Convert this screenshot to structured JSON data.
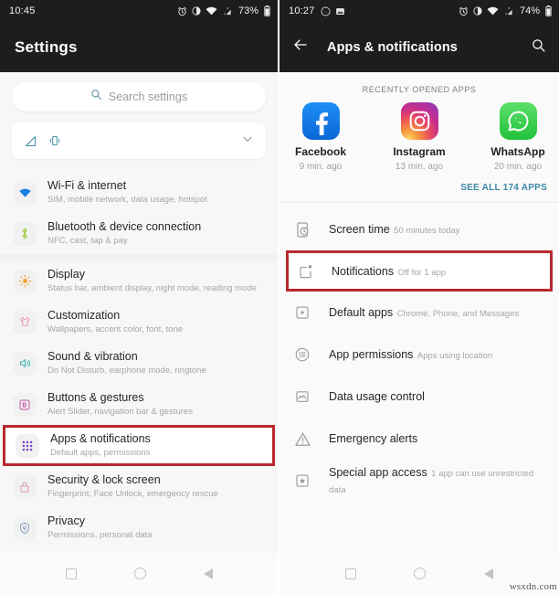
{
  "left": {
    "status": {
      "clock": "10:45",
      "battery_pct": "73%",
      "icons": [
        "alarm-icon",
        "dnd-icon",
        "wifi-icon",
        "signal-off-icon",
        "battery-icon"
      ]
    },
    "appbar": {
      "title": "Settings"
    },
    "search": {
      "placeholder": "Search settings",
      "icon": "search-icon"
    },
    "quick_settings": {
      "icons": [
        "signal-off-icon",
        "vibrate-icon"
      ],
      "expand_icon": "chevron-down-icon"
    },
    "groups": [
      {
        "items": [
          {
            "title": "Wi-Fi & internet",
            "subtitle": "SIM, mobile network, data usage, hotspot",
            "icon": "wifi-icon",
            "color": "#1b7fe0",
            "highlight": false
          },
          {
            "title": "Bluetooth & device connection",
            "subtitle": "NFC, cast, tap & pay",
            "icon": "bluetooth-icon",
            "color": "#9cc93b",
            "highlight": false
          }
        ]
      },
      {
        "items": [
          {
            "title": "Display",
            "subtitle": "Status bar, ambient display, night mode, reading mode",
            "icon": "brightness-icon",
            "color": "#f3a62a",
            "highlight": false
          },
          {
            "title": "Customization",
            "subtitle": "Wallpapers, accent color, font, tone",
            "icon": "tshirt-icon",
            "color": "#ef9aa8",
            "highlight": false
          },
          {
            "title": "Sound & vibration",
            "subtitle": "Do Not Disturb, earphone mode, ringtone",
            "icon": "speaker-icon",
            "color": "#39b3a7",
            "highlight": false
          },
          {
            "title": "Buttons & gestures",
            "subtitle": "Alert Slider, navigation bar & gestures",
            "icon": "buttons-icon",
            "color": "#c0519c",
            "highlight": false
          },
          {
            "title": "Apps & notifications",
            "subtitle": "Default apps, permissions",
            "icon": "apps-grid-icon",
            "color": "#7a45c9",
            "highlight": true
          },
          {
            "title": "Security & lock screen",
            "subtitle": "Fingerprint, Face Unlock, emergency rescue",
            "icon": "lock-icon",
            "color": "#e09aa0",
            "highlight": false
          },
          {
            "title": "Privacy",
            "subtitle": "Permissions, personal data",
            "icon": "shield-icon",
            "color": "#7d97b5",
            "highlight": false
          }
        ]
      }
    ],
    "navbar": [
      "recents-square-icon",
      "home-circle-icon",
      "back-triangle-icon"
    ]
  },
  "right": {
    "status": {
      "clock": "10:27",
      "battery_pct": "74%",
      "left_icons": [
        "whatsapp-icon",
        "screenshot-icon"
      ],
      "icons": [
        "alarm-icon",
        "dnd-icon",
        "wifi-icon",
        "signal-off-icon",
        "battery-icon"
      ]
    },
    "appbar": {
      "title": "Apps & notifications",
      "back_icon": "back-arrow-icon",
      "search_icon": "search-icon"
    },
    "recent_label": "RECENTLY OPENED APPS",
    "recent_apps": [
      {
        "name": "Facebook",
        "time": "9 min. ago",
        "icon": "facebook-icon"
      },
      {
        "name": "Instagram",
        "time": "13 min. ago",
        "icon": "instagram-icon"
      },
      {
        "name": "WhatsApp",
        "time": "20 min. ago",
        "icon": "whatsapp-icon"
      }
    ],
    "see_all": "SEE ALL 174 APPS",
    "items": [
      {
        "title": "Screen time",
        "subtitle": "50 minutes today",
        "icon": "screen-time-icon",
        "highlight": false
      },
      {
        "title": "Notifications",
        "subtitle": "Off for 1 app",
        "icon": "notification-dot-icon",
        "highlight": true
      },
      {
        "title": "Default apps",
        "subtitle": "Chrome, Phone, and Messages",
        "icon": "default-apps-icon",
        "highlight": false
      },
      {
        "title": "App permissions",
        "subtitle": "Apps using location",
        "icon": "permissions-list-icon",
        "highlight": false
      },
      {
        "title": "Data usage control",
        "subtitle": "",
        "icon": "data-usage-icon",
        "highlight": false
      },
      {
        "title": "Emergency alerts",
        "subtitle": "",
        "icon": "warning-triangle-icon",
        "highlight": false
      },
      {
        "title": "Special app access",
        "subtitle": "1 app can use unrestricted data",
        "icon": "special-access-icon",
        "highlight": false
      }
    ],
    "navbar": [
      "recents-square-icon",
      "home-circle-icon",
      "back-triangle-icon"
    ]
  },
  "watermark": "wsxdn.com",
  "colors": {
    "highlight_red": "#b8282e",
    "link_blue": "#3b87a8",
    "appbar_dark": "#1d1d1d"
  }
}
